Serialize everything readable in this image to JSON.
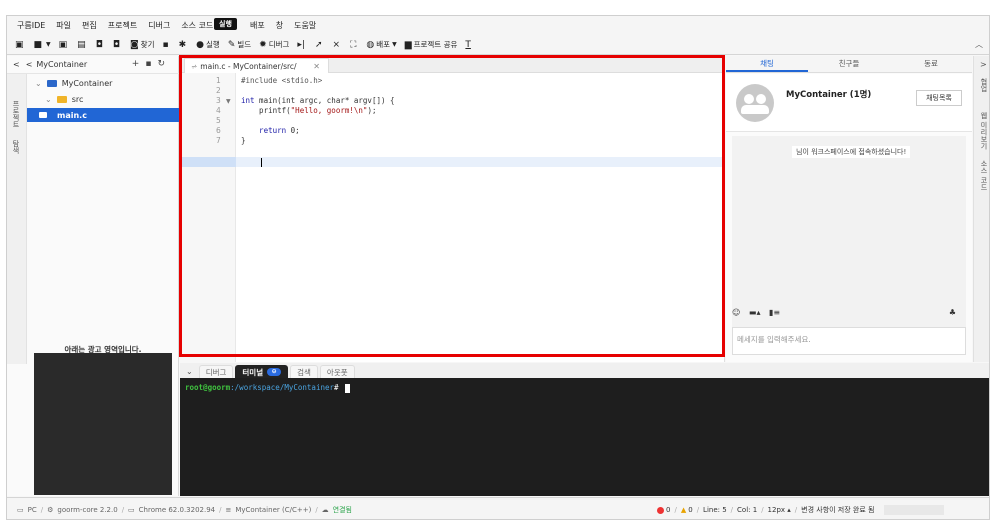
{
  "menu": [
    "구름IDE",
    "파일",
    "편집",
    "프로젝트",
    "디버그",
    "소스 코드",
    "실행",
    "배포",
    "창",
    "도움말"
  ],
  "tooltip": "실행",
  "toolbar": {
    "find": "찾기",
    "run": "실행",
    "build": "빌드",
    "debug": "디버그",
    "deploy": "배포",
    "share": "프로젝트 공유"
  },
  "project": {
    "title": "MyContainer",
    "side_tabs": [
      "프로젝트",
      "탐색"
    ],
    "tree": {
      "root": "MyContainer",
      "folder": "src",
      "file": "main.c"
    },
    "ad_label": "아래는 광고 영역입니다."
  },
  "editor": {
    "tab_title": "main.c - MyContainer/src/",
    "line_numbers": [
      "1",
      "2",
      "3",
      "4",
      "5",
      "6",
      "7"
    ],
    "code": {
      "l1": "#include <stdio.h>",
      "l3_kw": "int",
      "l3_rest": " main(int argc, char* argv[]) {",
      "l4_pre": "    printf(",
      "l4_str": "\"Hello, goorm!\\n\"",
      "l4_post": ");",
      "l6_kw": "    return",
      "l6_rest": " 0;",
      "l7": "}"
    }
  },
  "bottom": {
    "tabs": [
      "디버그",
      "터미널",
      "검색",
      "아웃풋"
    ],
    "active_tab": "터미널",
    "terminal": {
      "user": "root@goorm",
      "path": ":/workspace/MyContainer",
      "prompt": "# "
    }
  },
  "chat": {
    "tabs": [
      "채팅",
      "친구들",
      "동료"
    ],
    "room_title": "MyContainer (1명)",
    "list_button": "채팅목록",
    "system_message": "님이 워크스페이스에 접속하셨습니다!",
    "input_placeholder": "메세지를 입력해주세요.",
    "rail_tabs": [
      "협업",
      "웹 미리보기",
      "소스 코드"
    ]
  },
  "status": {
    "pc": "PC",
    "core": "goorm-core 2.2.0",
    "browser": "Chrome 62.0.3202.94",
    "container": "MyContainer (C/C++)",
    "connection": "연결됨",
    "errors": "0",
    "warnings": "0",
    "line": "Line: 5",
    "col": "Col: 1",
    "font": "12px",
    "save": "변경 사항이 저장 완료 됨"
  }
}
